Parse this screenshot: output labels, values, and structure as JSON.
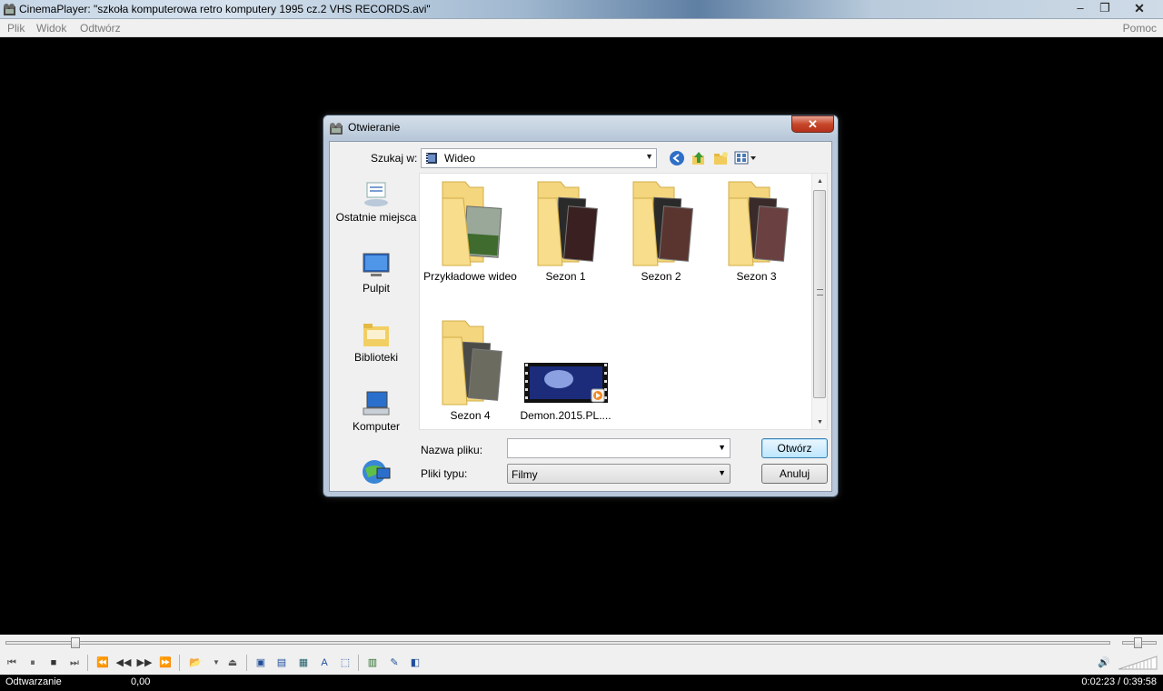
{
  "window": {
    "title": "CinemaPlayer: \"szkoła komputerowa retro komputery 1995  cz.2  VHS RECORDS.avi\"",
    "minimize": "‒",
    "maximize": "❐",
    "close": "✕"
  },
  "menu": {
    "file": "Plik",
    "view": "Widok",
    "play": "Odtwórz",
    "help": "Pomoc"
  },
  "dialog": {
    "title": "Otwieranie",
    "close": "✕",
    "look_in_label": "Szukaj w:",
    "look_in_value": "Wideo",
    "places": [
      {
        "label": "Ostatnie miejsca",
        "icon": "recent-places-icon"
      },
      {
        "label": "Pulpit",
        "icon": "desktop-icon"
      },
      {
        "label": "Biblioteki",
        "icon": "libraries-icon"
      },
      {
        "label": "Komputer",
        "icon": "computer-icon"
      },
      {
        "label": "",
        "icon": "network-icon"
      }
    ],
    "files": [
      {
        "name": "Przykładowe wideo",
        "type": "folder"
      },
      {
        "name": "Sezon 1",
        "type": "folder"
      },
      {
        "name": "Sezon 2",
        "type": "folder"
      },
      {
        "name": "Sezon 3",
        "type": "folder"
      },
      {
        "name": "Sezon 4",
        "type": "folder"
      },
      {
        "name": "Demon.2015.PL....",
        "type": "video"
      }
    ],
    "filename_label": "Nazwa pliku:",
    "filename_value": "",
    "filetype_label": "Pliki typu:",
    "filetype_value": "Filmy",
    "open_button": "Otwórz",
    "cancel_button": "Anuluj"
  },
  "player": {
    "seek_fraction": 0.06,
    "status": "Odtwarzanie",
    "rate": "0,00",
    "time": "0:02:23  / 0:39:58"
  },
  "colors": {
    "folder": "#f3d67e",
    "accent": "#3c7fb1"
  }
}
